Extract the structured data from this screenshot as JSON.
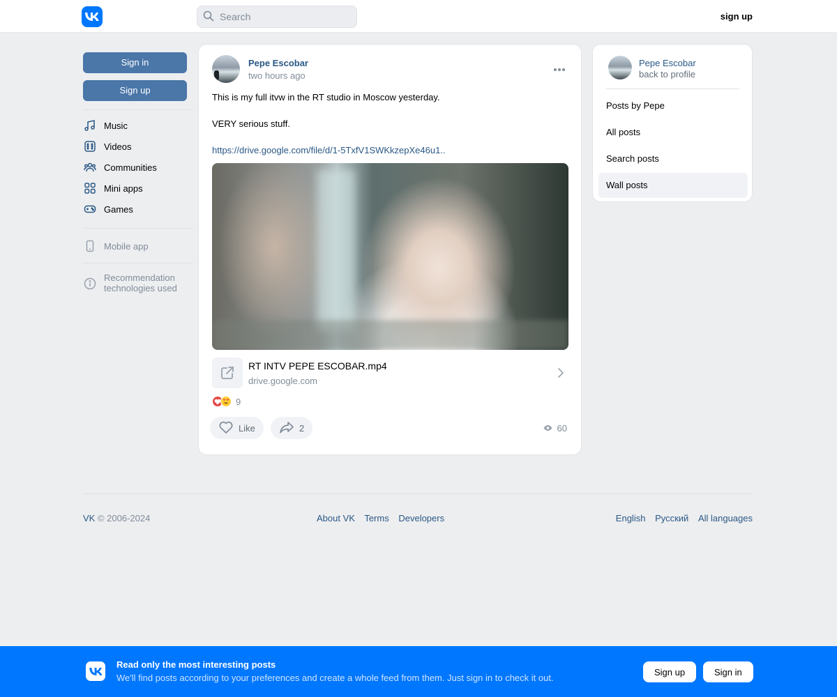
{
  "header": {
    "logo_icon": "vk-logo-icon",
    "search_placeholder": "Search",
    "signup_label": "sign up"
  },
  "left_sidebar": {
    "signin_label": "Sign in",
    "signup_label": "Sign up",
    "nav": [
      {
        "label": "Music",
        "icon": "music-note-icon"
      },
      {
        "label": "Videos",
        "icon": "video-icon"
      },
      {
        "label": "Communities",
        "icon": "users-icon"
      },
      {
        "label": "Mini apps",
        "icon": "apps-grid-icon"
      },
      {
        "label": "Games",
        "icon": "gamepad-icon"
      }
    ],
    "mobile_app_label": "Mobile app",
    "recommendation_label_1": "Recommendation",
    "recommendation_label_2": "technologies used"
  },
  "post": {
    "author": "Pepe Escobar",
    "time": "two hours ago",
    "text_line_1": "This is my full itvw in the RT studio in Moscow yesterday.",
    "text_line_2": "VERY serious stuff.",
    "link_text": "https://drive.google.com/file/d/1-5TxfV1SWKkzepXe46u1..",
    "attachment_title": "RT INTV PEPE ESCOBAR.mp4",
    "attachment_domain": "drive.google.com",
    "reactions_count": "9",
    "like_label": "Like",
    "share_count": "2",
    "views_count": "60"
  },
  "right_panel": {
    "name": "Pepe Escobar",
    "back_label": "back to profile",
    "items": [
      {
        "label": "Posts by Pepe"
      },
      {
        "label": "All posts"
      },
      {
        "label": "Search posts"
      },
      {
        "label": "Wall posts"
      }
    ]
  },
  "footer": {
    "vk": "VK",
    "copyright": " © 2006-2024",
    "links": [
      "About VK",
      "Terms",
      "Developers"
    ],
    "languages": [
      "English",
      "Русский",
      "All languages"
    ]
  },
  "banner": {
    "title": "Read only the most interesting posts",
    "subtitle": "We'll find posts according to your preferences and create a whole feed from them. Just sign in to check it out.",
    "signup_label": "Sign up",
    "signin_label": "Sign in"
  },
  "colors": {
    "brand": "#0077ff",
    "button": "#4a76a8",
    "link": "#2a5885",
    "background": "#edeef0"
  }
}
